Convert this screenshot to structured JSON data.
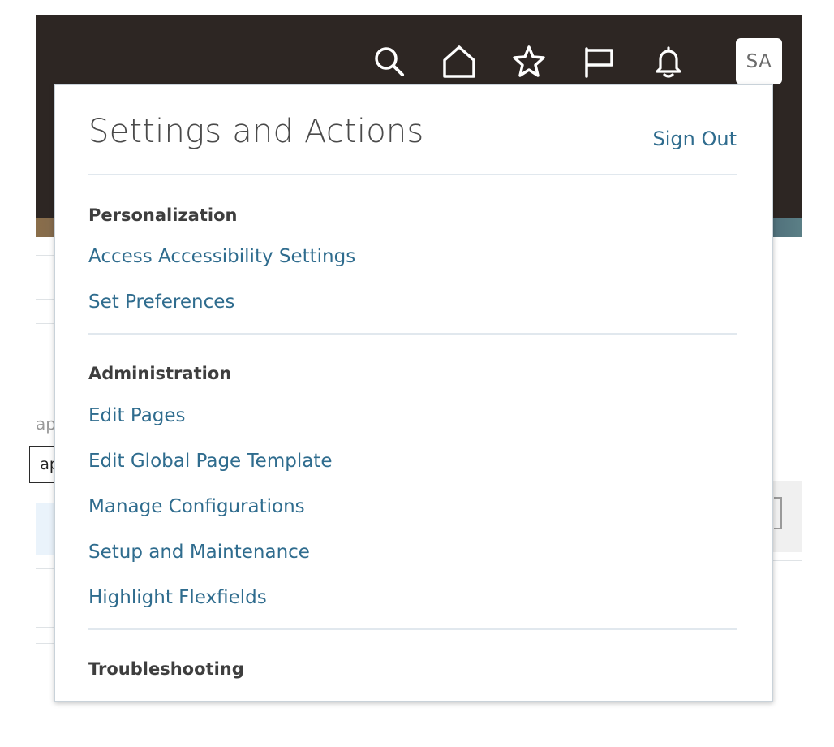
{
  "header": {
    "icons": [
      {
        "name": "search-icon"
      },
      {
        "name": "home-icon"
      },
      {
        "name": "favorites-star-icon"
      },
      {
        "name": "watchlist-flag-icon"
      },
      {
        "name": "notifications-bell-icon"
      }
    ],
    "avatar_initials": "SA"
  },
  "background": {
    "partial_text": "ap",
    "partial_button_label": "ap"
  },
  "popup": {
    "title": "Settings and Actions",
    "sign_out": "Sign Out",
    "sections": [
      {
        "heading": "Personalization",
        "items": [
          "Access Accessibility Settings",
          "Set Preferences"
        ]
      },
      {
        "heading": "Administration",
        "items": [
          "Edit Pages",
          "Edit Global Page Template",
          "Manage Configurations",
          "Setup and Maintenance",
          "Highlight Flexfields"
        ]
      },
      {
        "heading": "Troubleshooting",
        "items": []
      }
    ]
  },
  "colors": {
    "topbar": "#2d2623",
    "link": "#2f6c8e",
    "heading": "#3e3e3e",
    "title": "#4a4a4a",
    "divider": "#e1e8ee"
  }
}
